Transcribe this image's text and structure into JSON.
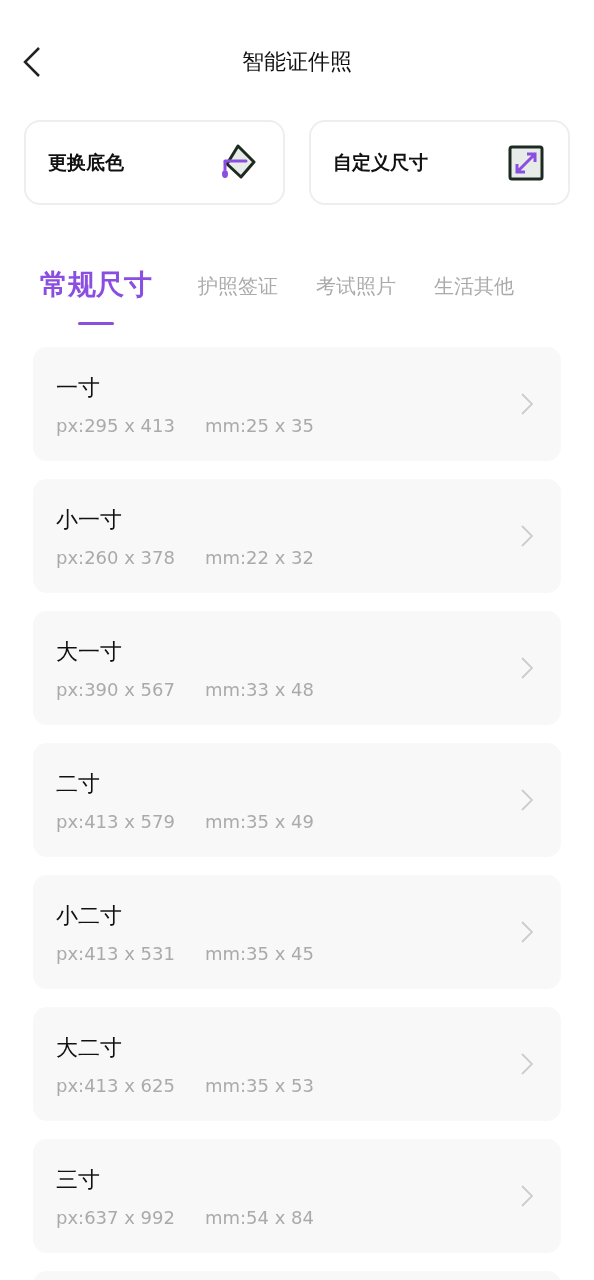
{
  "header": {
    "title": "智能证件照"
  },
  "actions": [
    {
      "kind": "paint",
      "label": "更换底色"
    },
    {
      "kind": "resize",
      "label": "自定义尺寸"
    }
  ],
  "tabs": [
    {
      "label": "常规尺寸",
      "selected": true
    },
    {
      "label": "护照签证",
      "selected": false
    },
    {
      "label": "考试照片",
      "selected": false
    },
    {
      "label": "生活其他",
      "selected": false
    }
  ],
  "sizes": [
    {
      "name": "一寸",
      "px": "px:295 x 413",
      "mm": "mm:25 x 35"
    },
    {
      "name": "小一寸",
      "px": "px:260 x 378",
      "mm": "mm:22 x 32"
    },
    {
      "name": "大一寸",
      "px": "px:390 x 567",
      "mm": "mm:33 x 48"
    },
    {
      "name": "二寸",
      "px": "px:413 x 579",
      "mm": "mm:35 x 49"
    },
    {
      "name": "小二寸",
      "px": "px:413 x 531",
      "mm": "mm:35 x 45"
    },
    {
      "name": "大二寸",
      "px": "px:413 x 625",
      "mm": "mm:35 x 53"
    },
    {
      "name": "三寸",
      "px": "px:637 x 992",
      "mm": "mm:54 x 84"
    }
  ]
}
